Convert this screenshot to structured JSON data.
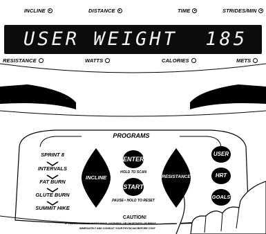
{
  "indicators_top": [
    {
      "label": "INCLINE",
      "on": true
    },
    {
      "label": "DISTANCE",
      "on": true
    },
    {
      "label": "TIME",
      "on": true
    },
    {
      "label": "STRIDES/MIN",
      "on": true
    }
  ],
  "indicators_bottom": [
    {
      "label": "RESISTANCE",
      "on": false
    },
    {
      "label": "WATTS",
      "on": false
    },
    {
      "label": "CALORIES",
      "on": false
    },
    {
      "label": "METS",
      "on": false
    }
  ],
  "display": {
    "text": "USER WEIGHT  185"
  },
  "programs": {
    "title": "PROGRAMS",
    "items": [
      "SPRINT 8",
      "INTERVALS",
      "FAT BURN",
      "GLUTE BURN",
      "SUMMIT HIKE"
    ]
  },
  "buttons": {
    "incline": "INCLINE",
    "enter": "ENTER",
    "enter_caption": "HOLD TO SCAN",
    "start": "START",
    "start_caption": "PAUSE • HOLD TO RESET",
    "resistance": "RESISTANCE",
    "user": "USER",
    "hrt": "HRT",
    "goals": "GOALS"
  },
  "caution": {
    "title": "CAUTION!",
    "line1": "IF YOU EXPERIENCE CHEST PAINS, DIZZINESS, OR SHORTNESS OF BREAT",
    "line2": "IMMEDIATELY AND CONSULT YOUR PHYSICIAN BEFORE CONT"
  },
  "colors": {
    "display_bg": "#0d0d0d",
    "button": "#000000",
    "panel_stroke": "#000000"
  }
}
